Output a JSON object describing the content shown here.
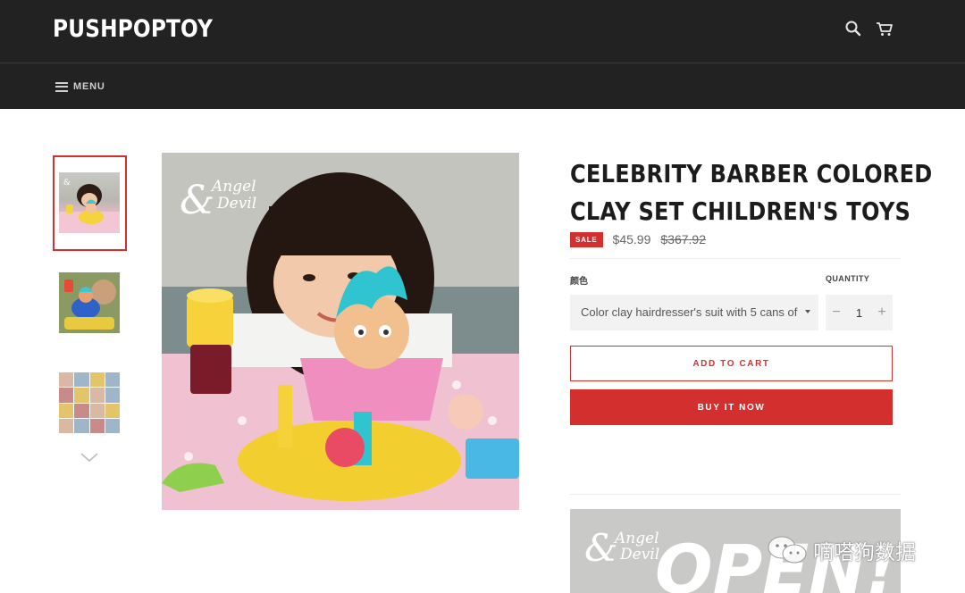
{
  "header": {
    "logo": "PUSHPOPTOY",
    "menu_label": "MENU",
    "icons": [
      "search-icon",
      "cart-icon"
    ]
  },
  "gallery": {
    "watermark_script": "Angel",
    "watermark_script2": "Devil",
    "thumbnails_icon": "chevron-down-icon"
  },
  "product": {
    "title_line1": "CELEBRITY BARBER COLORED",
    "title_line2": "CLAY SET CHILDREN'S TOYS",
    "sale_badge": "SALE",
    "price": "$45.99",
    "compare_price": "$367.92",
    "color_label": "颜色",
    "quantity_label": "QUANTITY",
    "color_value": "Color clay hairdresser's suit with 5 cans of",
    "quantity_value": "1",
    "minus": "−",
    "plus": "+",
    "add_to_cart": "ADD TO CART",
    "buy_now": "BUY IT NOW"
  },
  "description": {
    "image_text": "OPEN!"
  },
  "overlay_watermark": {
    "text": "嘀嗒狗数据"
  },
  "colors": {
    "header_bg": "#222222",
    "accent_red": "#d32f2f",
    "field_bg": "#f2f2f2"
  }
}
